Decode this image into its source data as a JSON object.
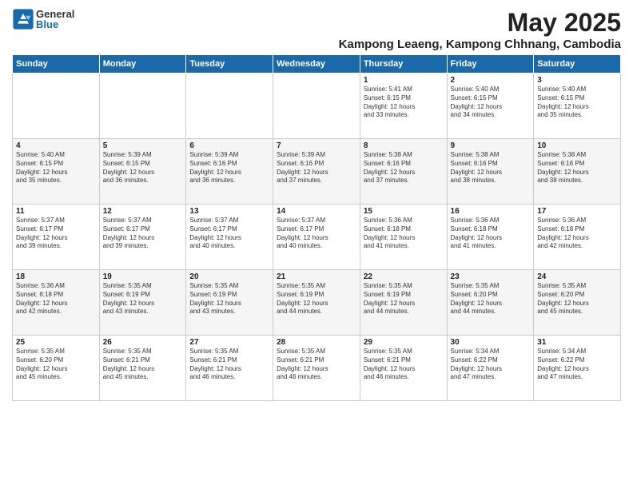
{
  "logo": {
    "general": "General",
    "blue": "Blue"
  },
  "title": {
    "month_year": "May 2025",
    "location": "Kampong Leaeng, Kampong Chhnang, Cambodia"
  },
  "weekdays": [
    "Sunday",
    "Monday",
    "Tuesday",
    "Wednesday",
    "Thursday",
    "Friday",
    "Saturday"
  ],
  "weeks": [
    [
      {
        "day": "",
        "info": ""
      },
      {
        "day": "",
        "info": ""
      },
      {
        "day": "",
        "info": ""
      },
      {
        "day": "",
        "info": ""
      },
      {
        "day": "1",
        "info": "Sunrise: 5:41 AM\nSunset: 6:15 PM\nDaylight: 12 hours\nand 33 minutes."
      },
      {
        "day": "2",
        "info": "Sunrise: 5:40 AM\nSunset: 6:15 PM\nDaylight: 12 hours\nand 34 minutes."
      },
      {
        "day": "3",
        "info": "Sunrise: 5:40 AM\nSunset: 6:15 PM\nDaylight: 12 hours\nand 35 minutes."
      }
    ],
    [
      {
        "day": "4",
        "info": "Sunrise: 5:40 AM\nSunset: 6:15 PM\nDaylight: 12 hours\nand 35 minutes."
      },
      {
        "day": "5",
        "info": "Sunrise: 5:39 AM\nSunset: 6:15 PM\nDaylight: 12 hours\nand 36 minutes."
      },
      {
        "day": "6",
        "info": "Sunrise: 5:39 AM\nSunset: 6:16 PM\nDaylight: 12 hours\nand 36 minutes."
      },
      {
        "day": "7",
        "info": "Sunrise: 5:39 AM\nSunset: 6:16 PM\nDaylight: 12 hours\nand 37 minutes."
      },
      {
        "day": "8",
        "info": "Sunrise: 5:38 AM\nSunset: 6:16 PM\nDaylight: 12 hours\nand 37 minutes."
      },
      {
        "day": "9",
        "info": "Sunrise: 5:38 AM\nSunset: 6:16 PM\nDaylight: 12 hours\nand 38 minutes."
      },
      {
        "day": "10",
        "info": "Sunrise: 5:38 AM\nSunset: 6:16 PM\nDaylight: 12 hours\nand 38 minutes."
      }
    ],
    [
      {
        "day": "11",
        "info": "Sunrise: 5:37 AM\nSunset: 6:17 PM\nDaylight: 12 hours\nand 39 minutes."
      },
      {
        "day": "12",
        "info": "Sunrise: 5:37 AM\nSunset: 6:17 PM\nDaylight: 12 hours\nand 39 minutes."
      },
      {
        "day": "13",
        "info": "Sunrise: 5:37 AM\nSunset: 6:17 PM\nDaylight: 12 hours\nand 40 minutes."
      },
      {
        "day": "14",
        "info": "Sunrise: 5:37 AM\nSunset: 6:17 PM\nDaylight: 12 hours\nand 40 minutes."
      },
      {
        "day": "15",
        "info": "Sunrise: 5:36 AM\nSunset: 6:18 PM\nDaylight: 12 hours\nand 41 minutes."
      },
      {
        "day": "16",
        "info": "Sunrise: 5:36 AM\nSunset: 6:18 PM\nDaylight: 12 hours\nand 41 minutes."
      },
      {
        "day": "17",
        "info": "Sunrise: 5:36 AM\nSunset: 6:18 PM\nDaylight: 12 hours\nand 42 minutes."
      }
    ],
    [
      {
        "day": "18",
        "info": "Sunrise: 5:36 AM\nSunset: 6:18 PM\nDaylight: 12 hours\nand 42 minutes."
      },
      {
        "day": "19",
        "info": "Sunrise: 5:35 AM\nSunset: 6:19 PM\nDaylight: 12 hours\nand 43 minutes."
      },
      {
        "day": "20",
        "info": "Sunrise: 5:35 AM\nSunset: 6:19 PM\nDaylight: 12 hours\nand 43 minutes."
      },
      {
        "day": "21",
        "info": "Sunrise: 5:35 AM\nSunset: 6:19 PM\nDaylight: 12 hours\nand 44 minutes."
      },
      {
        "day": "22",
        "info": "Sunrise: 5:35 AM\nSunset: 6:19 PM\nDaylight: 12 hours\nand 44 minutes."
      },
      {
        "day": "23",
        "info": "Sunrise: 5:35 AM\nSunset: 6:20 PM\nDaylight: 12 hours\nand 44 minutes."
      },
      {
        "day": "24",
        "info": "Sunrise: 5:35 AM\nSunset: 6:20 PM\nDaylight: 12 hours\nand 45 minutes."
      }
    ],
    [
      {
        "day": "25",
        "info": "Sunrise: 5:35 AM\nSunset: 6:20 PM\nDaylight: 12 hours\nand 45 minutes."
      },
      {
        "day": "26",
        "info": "Sunrise: 5:35 AM\nSunset: 6:21 PM\nDaylight: 12 hours\nand 45 minutes."
      },
      {
        "day": "27",
        "info": "Sunrise: 5:35 AM\nSunset: 6:21 PM\nDaylight: 12 hours\nand 46 minutes."
      },
      {
        "day": "28",
        "info": "Sunrise: 5:35 AM\nSunset: 6:21 PM\nDaylight: 12 hours\nand 46 minutes."
      },
      {
        "day": "29",
        "info": "Sunrise: 5:35 AM\nSunset: 6:21 PM\nDaylight: 12 hours\nand 46 minutes."
      },
      {
        "day": "30",
        "info": "Sunrise: 5:34 AM\nSunset: 6:22 PM\nDaylight: 12 hours\nand 47 minutes."
      },
      {
        "day": "31",
        "info": "Sunrise: 5:34 AM\nSunset: 6:22 PM\nDaylight: 12 hours\nand 47 minutes."
      }
    ]
  ]
}
